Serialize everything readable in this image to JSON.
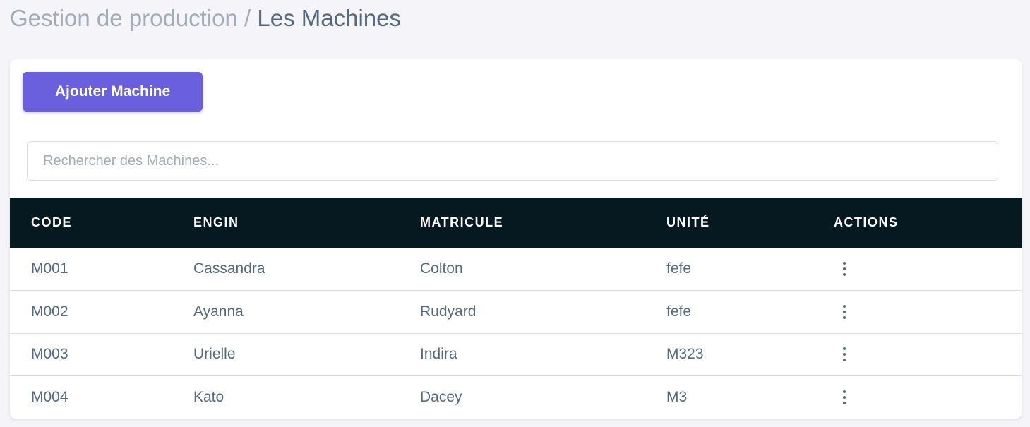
{
  "breadcrumb": {
    "parent": "Gestion de production",
    "separator": " / ",
    "current": "Les Machines"
  },
  "toolbar": {
    "add_label": "Ajouter Machine"
  },
  "search": {
    "placeholder": "Rechercher des Machines...",
    "value": ""
  },
  "table": {
    "headers": {
      "code": "CODE",
      "engin": "ENGIN",
      "matricule": "MATRICULE",
      "unite": "UNITÉ",
      "actions": "ACTIONS"
    },
    "rows": [
      {
        "code": "M001",
        "engin": "Cassandra",
        "matricule": "Colton",
        "unite": "fefe",
        "actions_icon": "more-vertical-icon"
      },
      {
        "code": "M002",
        "engin": "Ayanna",
        "matricule": "Rudyard",
        "unite": "fefe",
        "actions_icon": "more-vertical-icon"
      },
      {
        "code": "M003",
        "engin": "Urielle",
        "matricule": "Indira",
        "unite": "M323",
        "actions_icon": "more-vertical-icon"
      },
      {
        "code": "M004",
        "engin": "Kato",
        "matricule": "Dacey",
        "unite": "M3",
        "actions_icon": "more-vertical-icon"
      }
    ]
  },
  "colors": {
    "accent": "#6a5fdc",
    "table_header_bg": "#061820",
    "page_bg": "#f5f5f9",
    "text": "#566a7f",
    "muted_text": "#a1acb8"
  }
}
